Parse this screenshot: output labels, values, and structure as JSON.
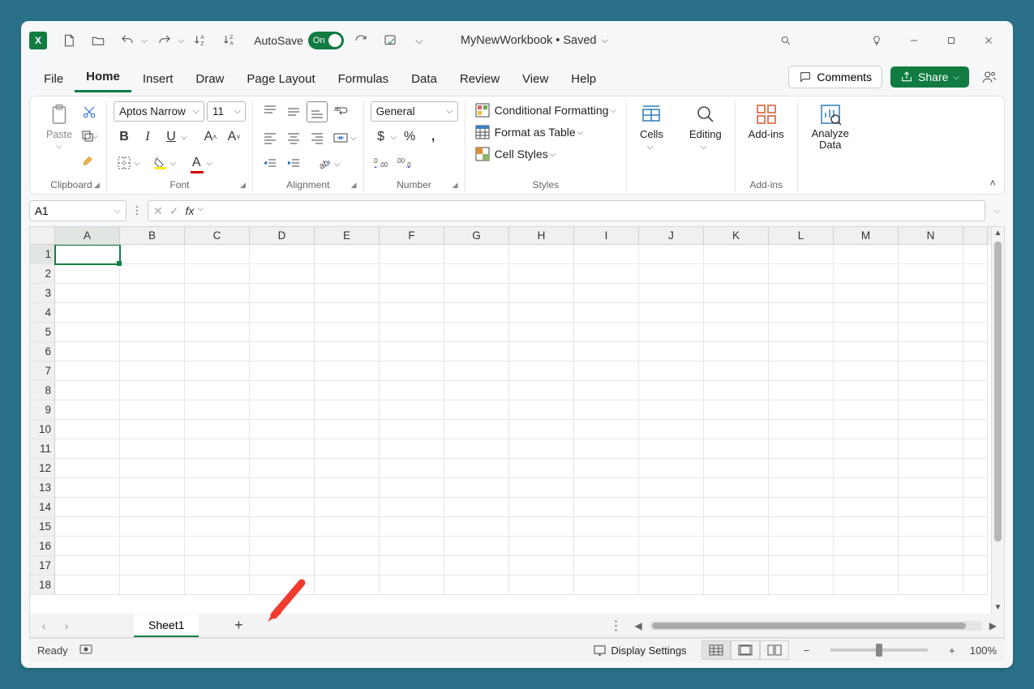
{
  "titlebar": {
    "autosave_label": "AutoSave",
    "autosave_state": "On",
    "doc_name": "MyNewWorkbook",
    "doc_status": "Saved"
  },
  "tabs": {
    "items": [
      "File",
      "Home",
      "Insert",
      "Draw",
      "Page Layout",
      "Formulas",
      "Data",
      "Review",
      "View",
      "Help"
    ],
    "active": "Home",
    "comments_label": "Comments",
    "share_label": "Share"
  },
  "ribbon": {
    "clipboard": {
      "label": "Clipboard",
      "paste": "Paste"
    },
    "font": {
      "label": "Font",
      "name": "Aptos Narrow",
      "size": "11",
      "bold": "B",
      "italic": "I",
      "underline": "U"
    },
    "alignment": {
      "label": "Alignment"
    },
    "number": {
      "label": "Number",
      "format": "General"
    },
    "styles": {
      "label": "Styles",
      "cond_fmt": "Conditional Formatting",
      "fmt_table": "Format as Table",
      "cell_styles": "Cell Styles"
    },
    "cells": {
      "label": "Cells"
    },
    "editing": {
      "label": "Editing"
    },
    "addins": {
      "label": "Add-ins",
      "btn": "Add-ins"
    },
    "analyze": {
      "label": "Analyze Data"
    }
  },
  "formula_bar": {
    "name_box": "A1",
    "fx": "fx"
  },
  "grid": {
    "columns": [
      "A",
      "B",
      "C",
      "D",
      "E",
      "F",
      "G",
      "H",
      "I",
      "J",
      "K",
      "L",
      "M",
      "N"
    ],
    "row_count": 18,
    "selected_cell": "A1"
  },
  "sheets": {
    "active": "Sheet1",
    "add_tooltip": "+"
  },
  "status": {
    "ready": "Ready",
    "display_settings": "Display Settings",
    "zoom": "100%"
  }
}
